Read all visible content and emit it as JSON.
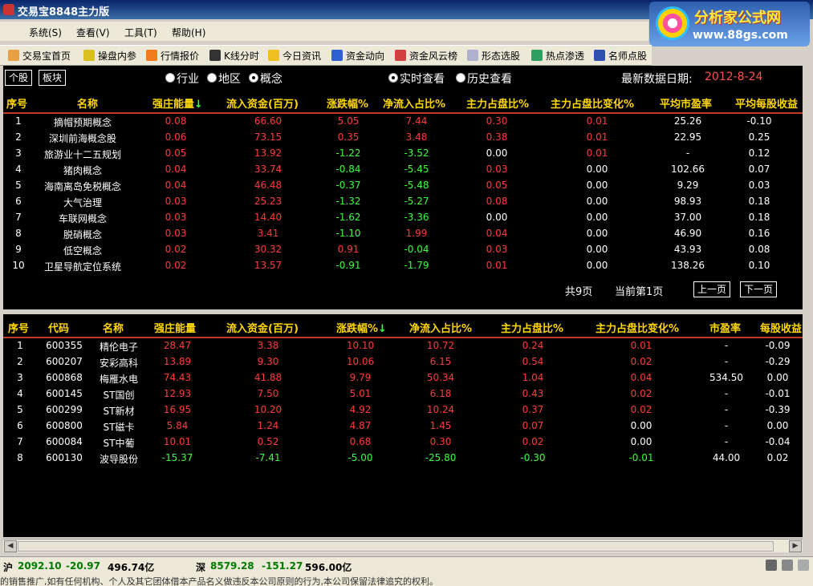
{
  "window": {
    "title": "交易宝8848主力版"
  },
  "logo": {
    "main": "分析家公式网",
    "sub": "www.88gs.com"
  },
  "menu": [
    "系统(S)",
    "查看(V)",
    "工具(T)",
    "帮助(H)"
  ],
  "toolbar": [
    "交易宝首页",
    "操盘内参",
    "行情报价",
    "K线分时",
    "今日资讯",
    "资金动向",
    "资金风云榜",
    "形态选股",
    "热点渗透",
    "名师点股"
  ],
  "colors": {
    "up": "#ff3b3b",
    "down": "#3cff3c",
    "header": "#ffd700",
    "bg": "#000000"
  },
  "controls": {
    "stock_btn": "个股",
    "sector_btn": "板块",
    "radio_industry": "行业",
    "radio_region": "地区",
    "radio_concept": "概念",
    "radio_realtime": "实时查看",
    "radio_history": "历史查看",
    "date_label": "最新数据日期:",
    "date_value": "2012-8-24"
  },
  "upper": {
    "headers": [
      "序号",
      "名称",
      "强庄能量",
      "流入资金(百万)",
      "涨跌幅%",
      "净流入占比%",
      "主力占盘比%",
      "主力占盘比变化%",
      "平均市盈率",
      "平均每股收益"
    ],
    "rows": [
      [
        "1",
        "摘帽预期概念",
        "0.08",
        "66.60",
        "5.05",
        "7.44",
        "0.30",
        "0.01",
        "25.26",
        "-0.10"
      ],
      [
        "2",
        "深圳前海概念股",
        "0.06",
        "73.15",
        "0.35",
        "3.48",
        "0.38",
        "0.01",
        "22.95",
        "0.25"
      ],
      [
        "3",
        "旅游业十二五规划",
        "0.05",
        "13.92",
        "-1.22",
        "-3.52",
        "0.00",
        "0.01",
        "-",
        "0.12"
      ],
      [
        "4",
        "猪肉概念",
        "0.04",
        "33.74",
        "-0.84",
        "-5.45",
        "0.03",
        "0.00",
        "102.66",
        "0.07"
      ],
      [
        "5",
        "海南离岛免税概念",
        "0.04",
        "46.48",
        "-0.37",
        "-5.48",
        "0.05",
        "0.00",
        "9.29",
        "0.03"
      ],
      [
        "6",
        "大气治理",
        "0.03",
        "25.23",
        "-1.32",
        "-5.27",
        "0.08",
        "0.00",
        "98.93",
        "0.18"
      ],
      [
        "7",
        "车联网概念",
        "0.03",
        "14.40",
        "-1.62",
        "-3.36",
        "0.00",
        "0.00",
        "37.00",
        "0.18"
      ],
      [
        "8",
        "脱硝概念",
        "0.03",
        "3.41",
        "-1.10",
        "1.99",
        "0.04",
        "0.00",
        "46.90",
        "0.16"
      ],
      [
        "9",
        "低空概念",
        "0.02",
        "30.32",
        "0.91",
        "-0.04",
        "0.03",
        "0.00",
        "43.93",
        "0.08"
      ],
      [
        "10",
        "卫星导航定位系统",
        "0.02",
        "13.57",
        "-0.91",
        "-1.79",
        "0.01",
        "0.00",
        "138.26",
        "0.10"
      ]
    ],
    "pager": {
      "total": "共9页",
      "current": "当前第1页",
      "prev": "上一页",
      "next": "下一页"
    }
  },
  "lower": {
    "headers": [
      "序号",
      "代码",
      "名称",
      "强庄能量",
      "流入资金(百万)",
      "涨跌幅%",
      "净流入占比%",
      "主力占盘比%",
      "主力占盘比变化%",
      "市盈率",
      "每股收益"
    ],
    "rows": [
      [
        "1",
        "600355",
        "精伦电子",
        "28.47",
        "3.38",
        "10.10",
        "10.72",
        "0.24",
        "0.01",
        "-",
        "-0.09"
      ],
      [
        "2",
        "600207",
        "安彩高科",
        "13.89",
        "9.30",
        "10.06",
        "6.15",
        "0.54",
        "0.02",
        "-",
        "-0.29"
      ],
      [
        "3",
        "600868",
        "梅雁水电",
        "74.43",
        "41.88",
        "9.79",
        "50.34",
        "1.04",
        "0.04",
        "534.50",
        "0.00"
      ],
      [
        "4",
        "600145",
        "ST国创",
        "12.93",
        "7.50",
        "5.01",
        "6.18",
        "0.43",
        "0.02",
        "-",
        "-0.01"
      ],
      [
        "5",
        "600299",
        "ST新材",
        "16.95",
        "10.20",
        "4.92",
        "10.24",
        "0.37",
        "0.02",
        "-",
        "-0.39"
      ],
      [
        "6",
        "600800",
        "ST磁卡",
        "5.84",
        "1.24",
        "4.87",
        "1.45",
        "0.07",
        "0.00",
        "-",
        "0.00"
      ],
      [
        "7",
        "600084",
        "ST中葡",
        "10.01",
        "0.52",
        "0.68",
        "0.30",
        "0.02",
        "0.00",
        "-",
        "-0.04"
      ],
      [
        "8",
        "600130",
        "波导股份",
        "-15.37",
        "-7.41",
        "-5.00",
        "-25.80",
        "-0.30",
        "-0.01",
        "44.00",
        "0.02"
      ]
    ]
  },
  "status": {
    "sh_label": "沪",
    "sh_index": "2092.10",
    "sh_change": "-20.97",
    "sh_volume": "496.74亿",
    "sz_label": "深",
    "sz_index": "8579.28",
    "sz_change": "-151.27",
    "sz_volume": "596.00亿",
    "ticker": "的销售推广,如有任何机构、个人及其它团体借本产品名义做违反本公司原则的行为,本公司保留法律追究的权利。"
  }
}
